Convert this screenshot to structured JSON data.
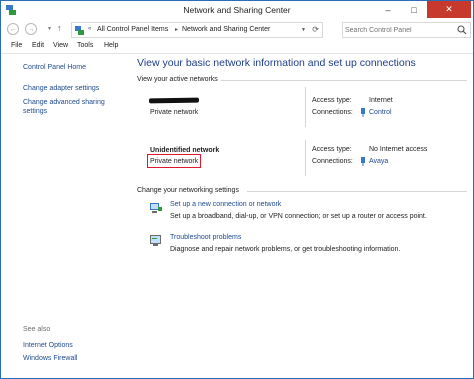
{
  "window": {
    "title": "Network and Sharing Center"
  },
  "address": {
    "overflow": "«",
    "crumbs": [
      "All Control Panel Items",
      "Network and Sharing Center"
    ],
    "search_placeholder": "Search Control Panel"
  },
  "menu": [
    "File",
    "Edit",
    "View",
    "Tools",
    "Help"
  ],
  "sidebar": {
    "home": "Control Panel Home",
    "links": [
      "Change adapter settings",
      "Change advanced sharing settings"
    ],
    "see_also_title": "See also",
    "see_also": [
      "Internet Options",
      "Windows Firewall"
    ]
  },
  "main": {
    "title": "View your basic network information and set up connections",
    "active_header": "View your active networks",
    "networks": [
      {
        "name": "",
        "type": "Private network",
        "access_label": "Access type:",
        "access_value": "Internet",
        "conn_label": "Connections:",
        "conn_value": "Control"
      },
      {
        "name": "Unidentified network",
        "type": "Private network",
        "access_label": "Access type:",
        "access_value": "No Internet access",
        "conn_label": "Connections:",
        "conn_value": "Avaya"
      }
    ],
    "settings_header": "Change your networking settings",
    "tasks": [
      {
        "link": "Set up a new connection or network",
        "desc": "Set up a broadband, dial-up, or VPN connection; or set up a router or access point."
      },
      {
        "link": "Troubleshoot problems",
        "desc": "Diagnose and repair network problems, or get troubleshooting information."
      }
    ]
  },
  "colors": {
    "link": "#1f4b8e",
    "title": "#1e3e88",
    "highlight": "#e0182b",
    "close": "#c7392c"
  }
}
